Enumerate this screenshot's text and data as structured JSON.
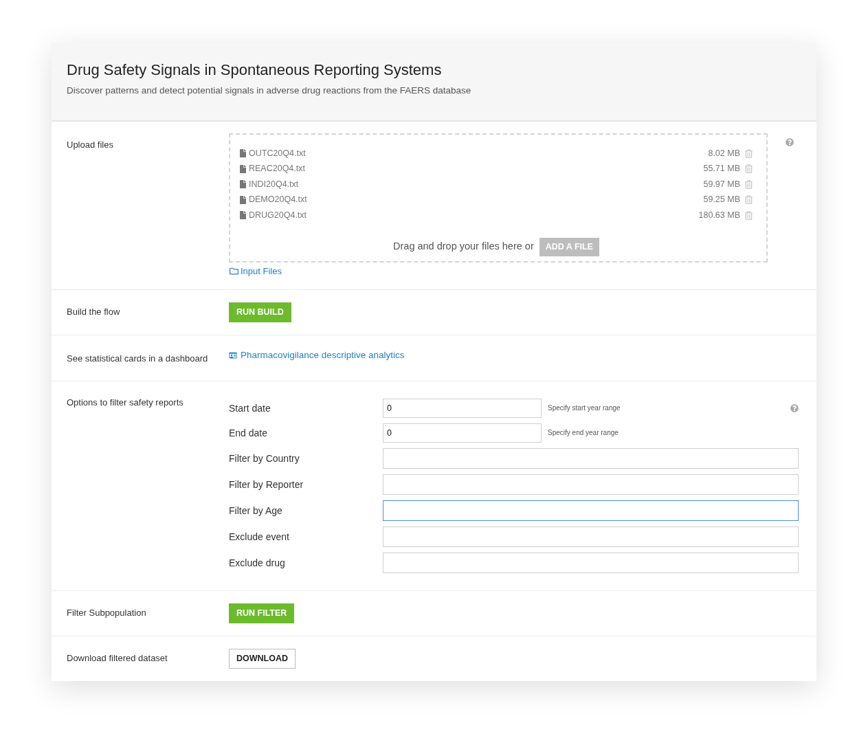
{
  "header": {
    "title": "Drug Safety Signals in Spontaneous Reporting Systems",
    "subtitle": "Discover patterns and detect potential signals in adverse drug reactions from the FAERS database"
  },
  "sections": [
    {
      "kind": "upload",
      "label": "Upload files",
      "files": [
        {
          "name": "OUTC20Q4.txt",
          "size": "8.02 MB"
        },
        {
          "name": "REAC20Q4.txt",
          "size": "55.71 MB"
        },
        {
          "name": "INDI20Q4.txt",
          "size": "59.97 MB"
        },
        {
          "name": "DEMO20Q4.txt",
          "size": "59.25 MB"
        },
        {
          "name": "DRUG20Q4.txt",
          "size": "180.63 MB"
        }
      ],
      "drop_text": "Drag and drop your files here or",
      "add_button": "ADD A FILE",
      "folder_link": "Input Files"
    },
    {
      "kind": "action",
      "label": "Build the flow",
      "button": {
        "kind": "primary",
        "text": "RUN BUILD"
      }
    },
    {
      "kind": "link",
      "label": "See statistical cards in a dashboard",
      "link": "Pharmacovigilance descriptive analytics"
    },
    {
      "kind": "form",
      "label": "Options to filter safety reports",
      "fields": [
        {
          "label": "Start date",
          "value": "0",
          "hint": "Specify start year range",
          "focused": false
        },
        {
          "label": "End date",
          "value": "0",
          "hint": "Specify end year range",
          "focused": false
        },
        {
          "label": "Filter by Country",
          "focused": false
        },
        {
          "label": "Filter by Reporter",
          "focused": false
        },
        {
          "label": "Filter by Age",
          "focused": true
        },
        {
          "label": "Exclude event",
          "focused": false
        },
        {
          "label": "Exclude drug",
          "focused": false
        }
      ]
    },
    {
      "kind": "action",
      "label": "Filter Subpopulation",
      "button": {
        "kind": "primary",
        "text": "RUN FILTER"
      }
    },
    {
      "kind": "action",
      "label": "Download filtered dataset",
      "button": {
        "kind": "secondary",
        "text": "DOWNLOAD"
      }
    }
  ]
}
